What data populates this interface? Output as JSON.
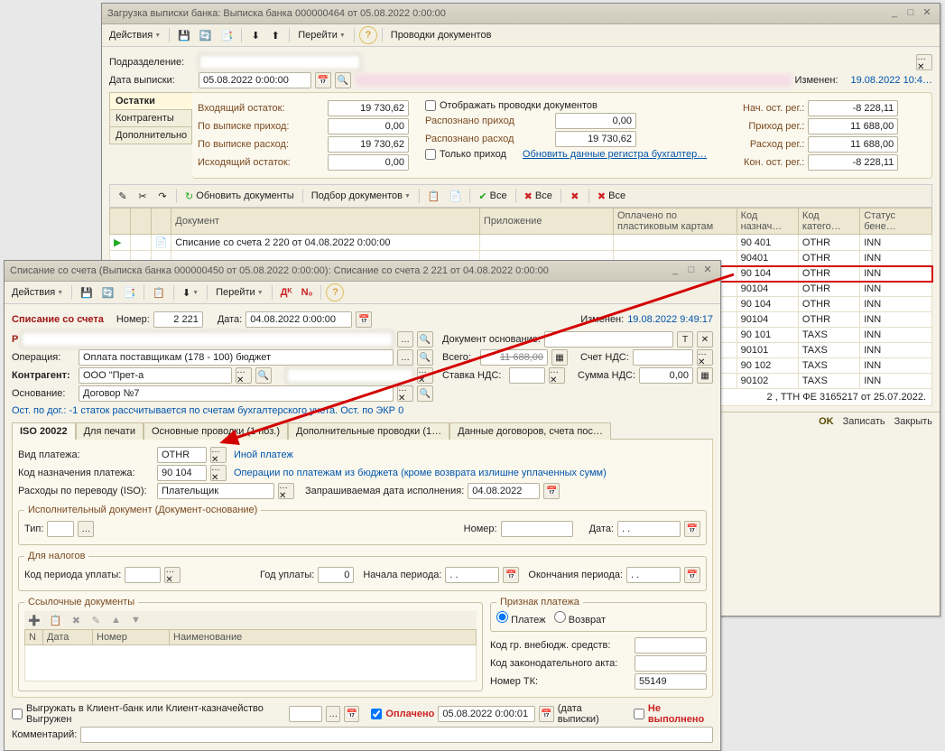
{
  "parent": {
    "title": "Загрузка выписки банка: Выписка банка 000000464 от 05.08.2022 0:00:00",
    "toolbar": {
      "actions": "Действия",
      "goto": "Перейти",
      "entries": "Проводки документов"
    },
    "subdiv_label": "Подразделение:",
    "date_label": "Дата выписки:",
    "date_value": "05.08.2022  0:00:00",
    "changed_label": "Изменен:",
    "changed_value": "19.08.2022 10:4…",
    "vtabs": [
      "Остатки",
      "Контрагенты",
      "Дополнительно"
    ],
    "stats": {
      "in_balance": {
        "l": "Входящий остаток:",
        "v": "19 730,62"
      },
      "in_income": {
        "l": "По выписке приход:",
        "v": "0,00"
      },
      "in_expense": {
        "l": "По выписке расход:",
        "v": "19 730,62"
      },
      "out_balance": {
        "l": "Исходящий остаток:",
        "v": "0,00"
      },
      "show_entries": "Отображать проводки документов",
      "income_only": "Только приход",
      "recog_income": {
        "l": "Распознано приход",
        "v": "0,00"
      },
      "recog_expense": {
        "l": "Распознано расход",
        "v": "19 730,62"
      },
      "update_link": "Обновить данные регистра бухгалтер…",
      "reg": {
        "start": {
          "l": "Нач. ост. рег.:",
          "v": "-8 228,11"
        },
        "income": {
          "l": "Приход рег.:",
          "v": "11 688,00"
        },
        "expense": {
          "l": "Расход рег.:",
          "v": "11 688,00"
        },
        "end": {
          "l": "Кон. ост. рег.:",
          "v": "-8 228,11"
        }
      }
    },
    "toolbar2": {
      "refresh": "Обновить документы",
      "pick": "Подбор документов",
      "all": "Все"
    },
    "grid": {
      "cols": [
        "Документ",
        "Приложение",
        "Оплачено по пластиковым картам",
        "Код назнач…",
        "Код катего…",
        "Статус бене…"
      ],
      "rows": [
        {
          "doc": "Списание со счета 2 220 от 04.08.2022 0:00:00",
          "c1": "90 401",
          "c2": "OTHR",
          "c3": "INN"
        },
        {
          "doc": "",
          "c1": "90401",
          "c2": "OTHR",
          "c3": "INN"
        },
        {
          "doc": "",
          "c1": "90 104",
          "c2": "OTHR",
          "c3": "INN",
          "hi": true
        },
        {
          "doc": "",
          "c1": "90104",
          "c2": "OTHR",
          "c3": "INN"
        },
        {
          "doc": "",
          "c1": "90 104",
          "c2": "OTHR",
          "c3": "INN"
        },
        {
          "doc": "",
          "c1": "90104",
          "c2": "OTHR",
          "c3": "INN"
        },
        {
          "doc": "",
          "c1": "90 101",
          "c2": "TAXS",
          "c3": "INN"
        },
        {
          "doc": "",
          "c1": "90101",
          "c2": "TAXS",
          "c3": "INN"
        },
        {
          "doc": "",
          "c1": "90 102",
          "c2": "TAXS",
          "c3": "INN"
        },
        {
          "doc": "",
          "c1": "90102",
          "c2": "TAXS",
          "c3": "INN"
        }
      ],
      "bottom_note": "2 , ТТН ФЕ 3165217 от 25.07.2022."
    },
    "buttons": {
      "ok": "OK",
      "save": "Записать",
      "close": "Закрыть"
    }
  },
  "child": {
    "title": "Списание со счета (Выписка банка 000000450 от 05.08.2022 0:00:00): Списание со счета 2 221 от 04.08.2022 0:00:00",
    "toolbar": {
      "actions": "Действия",
      "goto": "Перейти"
    },
    "head": {
      "title": "Списание со счета",
      "num_label": "Номер:",
      "num": "2 221",
      "date_label": "Дата:",
      "date": "04.08.2022  0:00:00",
      "changed_label": "Изменен:",
      "changed_value": "19.08.2022 9:49:17"
    },
    "op_label": "Операция:",
    "op_value": "Оплата поставщикам (178 - 100) бюджет",
    "contr_label": "Контрагент:",
    "contr_value": "ООО \"Прет-а",
    "basis_label": "Основание:",
    "basis_value": "Договор №7",
    "doc_basis": "Документ основание:",
    "total": "Всего:",
    "total_v": "11 688,00",
    "vat_acc": "Счет НДС:",
    "vat_rate": "Ставка НДС:",
    "vat_sum": "Сумма НДС:",
    "vat_sum_v": "0,00",
    "balance_line": "Ост. по дог.: -1            статок рассчитывается по счетам бухгалтерского учета. Ост. по ЭКР 0",
    "tabs": [
      "ISO 20022",
      "Для печати",
      "Основные проводки (1 поз.)",
      "Дополнительные проводки (1…",
      "Данные договоров, счета пос…"
    ],
    "iso": {
      "paytype_l": "Вид платежа:",
      "paytype_v": "OTHR",
      "paytype_hint": "Иной платеж",
      "purpose_l": "Код назначения платежа:",
      "purpose_v": "90 104",
      "purpose_hint": "Операции по платежам из бюджета (кроме возврата излишне уплаченных сумм)",
      "transfer_l": "Расходы по переводу (ISO):",
      "transfer_v": "Плательщик",
      "reqdate_l": "Запрашиваемая дата исполнения:",
      "reqdate_v": "04.08.2022",
      "exec_doc": "Исполнительный документ (Документ-основание)",
      "type_l": "Тип:",
      "number_l": "Номер:",
      "date_l": "Дата:",
      "date_empty": "  .  .",
      "taxes": "Для налогов",
      "period_code_l": "Код периода уплаты:",
      "year_l": "Год уплаты:",
      "year_v": "0",
      "start_l": "Начала периода:",
      "end_l": "Окончания периода:",
      "refdocs": "Ссылочные документы",
      "ref_cols": [
        "N",
        "Дата",
        "Номер",
        "Наименование"
      ],
      "payflag": "Признак платежа",
      "payment": "Платеж",
      "refund": "Возврат",
      "grp_l": "Код гр. внебюдж. средств:",
      "act_l": "Код законодательного акта:",
      "tk_l": "Номер ТК:",
      "tk_v": "55149"
    },
    "foot": {
      "export_l": "Выгружать в Клиент-банк или Клиент-казначейство Выгружен",
      "paid": "Оплачено",
      "paid_date": "05.08.2022  0:00:01",
      "paid_hint": "(дата выписки)",
      "not_done": "Не выполнено",
      "comment": "Комментарий:"
    }
  }
}
